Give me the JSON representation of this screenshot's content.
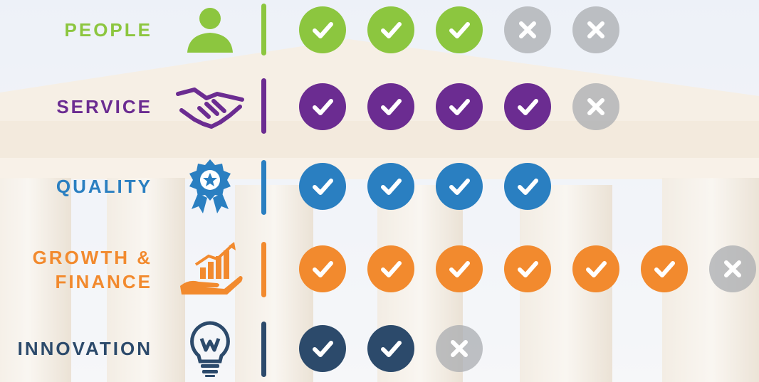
{
  "colors": {
    "people": "#8cc63f",
    "service": "#6b2c91",
    "quality": "#2a7fc1",
    "growth": "#f28a2e",
    "innovation": "#2c4a6b",
    "inactive": "#a9abaf"
  },
  "rows": [
    {
      "key": "people",
      "label_lines": [
        "PEOPLE"
      ],
      "icon": "person-icon",
      "checks": 3,
      "crosses": 2
    },
    {
      "key": "service",
      "label_lines": [
        "SERVICE"
      ],
      "icon": "handshake-icon",
      "checks": 4,
      "crosses": 1
    },
    {
      "key": "quality",
      "label_lines": [
        "QUALITY"
      ],
      "icon": "award-badge-icon",
      "checks": 4,
      "crosses": 0
    },
    {
      "key": "growth",
      "label_lines": [
        "GROWTH &",
        "FINANCE"
      ],
      "icon": "growth-chart-hand-icon",
      "checks": 6,
      "crosses": 1
    },
    {
      "key": "innovation",
      "label_lines": [
        "INNOVATION"
      ],
      "icon": "lightbulb-icon",
      "checks": 2,
      "crosses": 1
    }
  ]
}
